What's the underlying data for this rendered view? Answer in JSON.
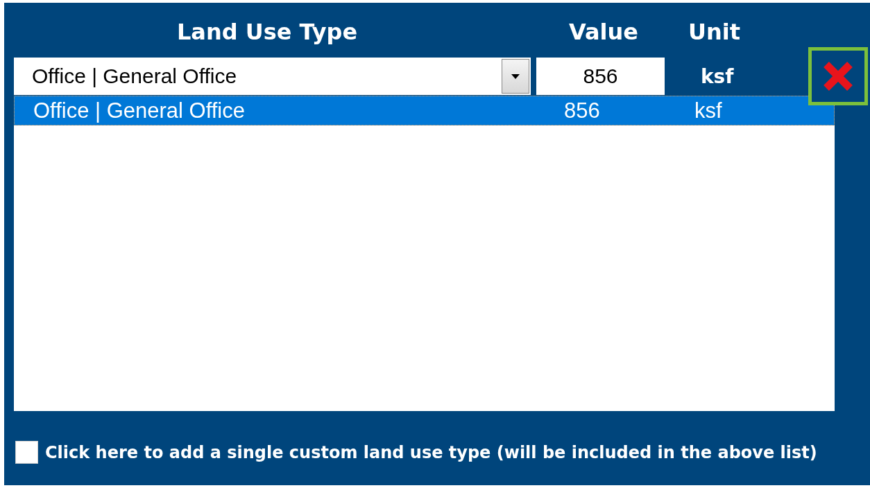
{
  "headers": {
    "land_use_type": "Land Use Type",
    "value": "Value",
    "unit": "Unit"
  },
  "entry": {
    "land_use_type": "Office | General Office",
    "value": "856",
    "unit": "ksf"
  },
  "list": [
    {
      "land_use_type": "Office | General Office",
      "value": "856",
      "unit": "ksf",
      "selected": true
    }
  ],
  "custom_checkbox": {
    "label": "Click here to add a single custom land use type (will be included in the above list)",
    "checked": false
  }
}
